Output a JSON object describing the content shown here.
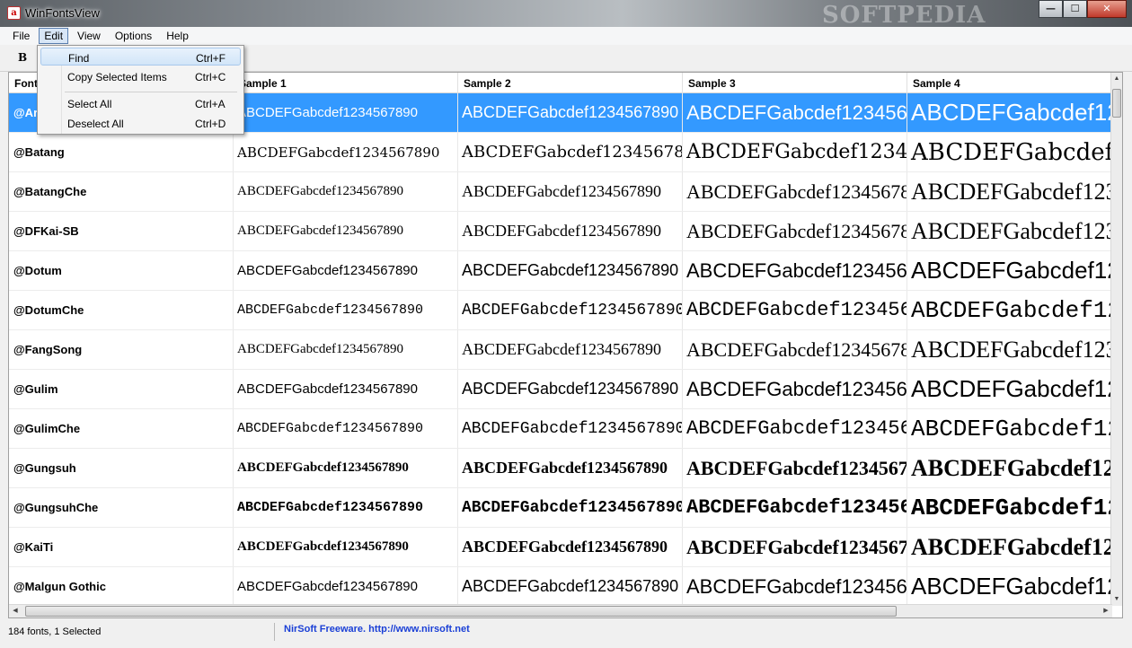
{
  "window": {
    "title": "WinFontsView",
    "watermark": "SOFTPEDIA"
  },
  "menu": [
    "File",
    "Edit",
    "View",
    "Options",
    "Help"
  ],
  "toolbar": {
    "bold_label": "B"
  },
  "edit_menu": {
    "items": [
      {
        "label": "Find",
        "shortcut": "Ctrl+F"
      },
      {
        "label": "Copy Selected Items",
        "shortcut": "Ctrl+C"
      },
      {
        "label": "Select All",
        "shortcut": "Ctrl+A"
      },
      {
        "label": "Deselect All",
        "shortcut": "Ctrl+D"
      }
    ]
  },
  "table": {
    "columns": [
      "Font",
      "Sample 1",
      "Sample 2",
      "Sample 3",
      "Sample 4"
    ],
    "sample_text": "ABCDEFGabcdef1234567890",
    "rows": [
      {
        "font": "@Arial Unicode MS",
        "selected": true
      },
      {
        "font": "@Batang"
      },
      {
        "font": "@BatangChe"
      },
      {
        "font": "@DFKai-SB"
      },
      {
        "font": "@Dotum"
      },
      {
        "font": "@DotumChe"
      },
      {
        "font": "@FangSong"
      },
      {
        "font": "@Gulim"
      },
      {
        "font": "@GulimChe"
      },
      {
        "font": "@Gungsuh"
      },
      {
        "font": "@GungsuhChe"
      },
      {
        "font": "@KaiTi"
      },
      {
        "font": "@Malgun Gothic"
      }
    ]
  },
  "status": {
    "summary": "184 fonts, 1 Selected",
    "link": "NirSoft Freeware.  http://www.nirsoft.net"
  }
}
